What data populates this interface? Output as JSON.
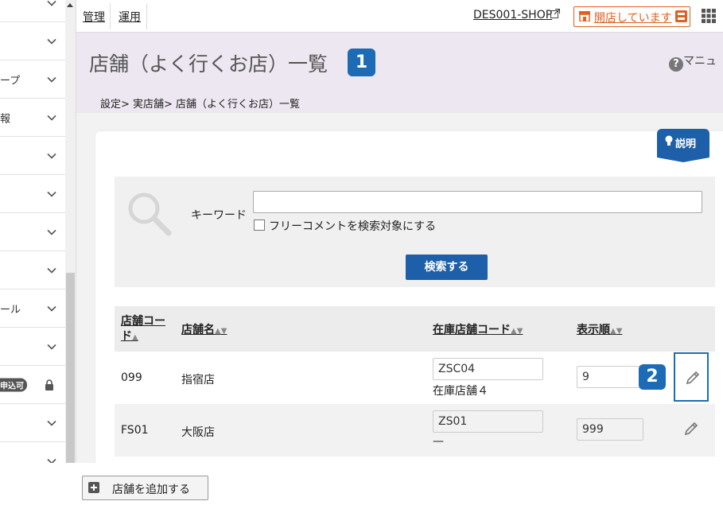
{
  "sidebar": {
    "items": [
      {
        "label": ""
      },
      {
        "label": ""
      },
      {
        "label": "ープ"
      },
      {
        "label": "報"
      },
      {
        "label": ""
      },
      {
        "label": ""
      },
      {
        "label": ""
      },
      {
        "label": ""
      },
      {
        "label": "ール"
      },
      {
        "label": ""
      },
      {
        "label": "申込可",
        "badge": true,
        "locked": true
      },
      {
        "label": ""
      },
      {
        "label": ""
      }
    ]
  },
  "topbar": {
    "manage": "管理",
    "operate": "運用",
    "shop_link": "DES001-SHOP",
    "open_status": "開店しています",
    "colors": {
      "accent": "#e06020"
    }
  },
  "header": {
    "title": "店舗（よく行くお店）一覧",
    "title_badge": "1",
    "help": "マニュ",
    "breadcrumb": "設定> 実店舗> 店舗（よく行くお店）一覧"
  },
  "explain_label": "説明",
  "search": {
    "keyword_label": "キーワード",
    "keyword_value": "",
    "free_comment_label": "フリーコメントを検索対象にする",
    "free_comment_checked": false,
    "search_button": "検索する"
  },
  "table": {
    "headers": {
      "code_line1": "店舗コー",
      "code_line2": "ド",
      "name": "店舗名",
      "stock_code": "在庫店舗コード",
      "order": "表示順"
    },
    "rows": [
      {
        "code": "099",
        "name": "指宿店",
        "stock_code": "ZSC04",
        "stock_name": "在庫店舗４",
        "order": "9"
      },
      {
        "code": "FS01",
        "name": "大阪店",
        "stock_code": "ZS01",
        "stock_name": "—",
        "order": "999"
      }
    ],
    "edit_badge": "2"
  },
  "footer": {
    "add_button": "店舗を追加する"
  }
}
